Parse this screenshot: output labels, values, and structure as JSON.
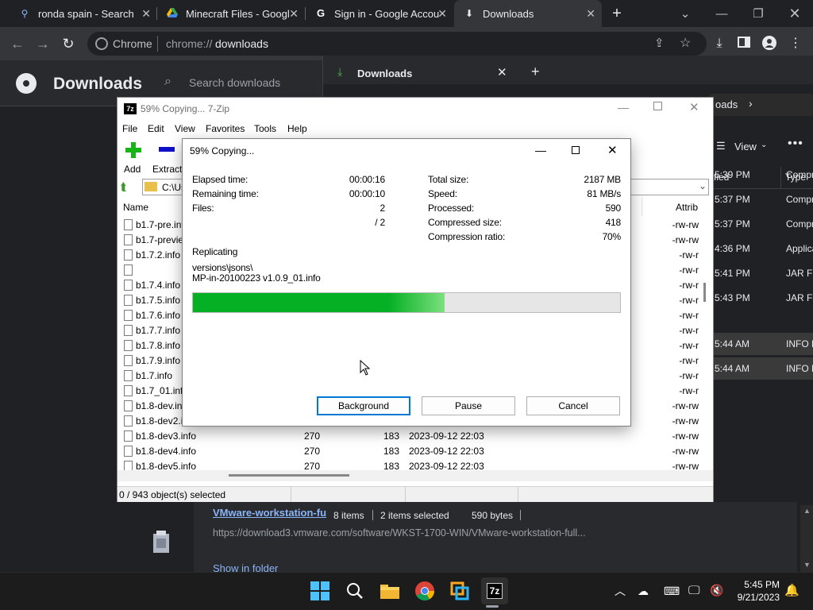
{
  "chrome": {
    "tabs": [
      {
        "label": "ronda spain - Search",
        "icon": "search-icon"
      },
      {
        "label": "Minecraft Files - Googl",
        "icon": "google-drive-icon"
      },
      {
        "label": "Sign in - Google Accou",
        "icon": "google-icon"
      },
      {
        "label": "Downloads",
        "icon": "download-icon"
      }
    ],
    "new_tab": "+",
    "omnibox": {
      "site_label": "Chrome",
      "url_prefix": "chrome://",
      "url_host": "downloads"
    }
  },
  "downloads_page": {
    "title": "Downloads",
    "search_placeholder": "Search downloads",
    "bubble_title": "Downloads",
    "bubble_plus": "+",
    "open_label": "oads",
    "view_label": "View",
    "col_modified": "fied",
    "col_type": "Type",
    "rows": [
      {
        "time": "5:39 PM",
        "type": "Compr"
      },
      {
        "time": "5:37 PM",
        "type": "Compr"
      },
      {
        "time": "5:37 PM",
        "type": "Compr"
      },
      {
        "time": "4:36 PM",
        "type": "Applica"
      },
      {
        "time": "5:41 PM",
        "type": "JAR File"
      },
      {
        "time": "5:43 PM",
        "type": "JAR File"
      },
      {
        "time": "5:44 AM",
        "type": "INFO F"
      },
      {
        "time": "5:44 AM",
        "type": "INFO F"
      }
    ],
    "status_items": "8 items",
    "status_selected": "2 items selected",
    "status_bytes": "590 bytes",
    "item_name": "VMware-workstation-fu",
    "item_url": "https://download3.vmware.com/software/WKST-1700-WIN/VMware-workstation-full...",
    "show_in_folder": "Show in folder"
  },
  "zip_main": {
    "title": "59% Copying... 7-Zip",
    "menu": [
      "File",
      "Edit",
      "View",
      "Favorites",
      "Tools",
      "Help"
    ],
    "toolbar": {
      "add": "Add",
      "extract": "Extract"
    },
    "path": "C:\\Us",
    "col_name": "Name",
    "col_attrib": "Attrib",
    "files": [
      {
        "name": "b1.7-pre.inf",
        "size": "",
        "packed": "",
        "date": "",
        "attr": "-rw-rw"
      },
      {
        "name": "b1.7-previe",
        "size": "",
        "packed": "",
        "date": "",
        "attr": "-rw-rw"
      },
      {
        "name": "b1.7.2.info",
        "size": "",
        "packed": "",
        "date": "",
        "attr": "-rw-r"
      },
      {
        "name": "",
        "size": "",
        "packed": "",
        "date": "",
        "attr": "-rw-r"
      },
      {
        "name": "b1.7.4.info",
        "size": "",
        "packed": "",
        "date": "",
        "attr": "-rw-r"
      },
      {
        "name": "b1.7.5.info",
        "size": "",
        "packed": "",
        "date": "",
        "attr": "-rw-r"
      },
      {
        "name": "b1.7.6.info",
        "size": "",
        "packed": "",
        "date": "",
        "attr": "-rw-r"
      },
      {
        "name": "b1.7.7.info",
        "size": "",
        "packed": "",
        "date": "",
        "attr": "-rw-r"
      },
      {
        "name": "b1.7.8.info",
        "size": "",
        "packed": "",
        "date": "",
        "attr": "-rw-r"
      },
      {
        "name": "b1.7.9.info",
        "size": "",
        "packed": "",
        "date": "",
        "attr": "-rw-r"
      },
      {
        "name": "b1.7.info",
        "size": "",
        "packed": "",
        "date": "",
        "attr": "-rw-r"
      },
      {
        "name": "b1.7_01.info",
        "size": "",
        "packed": "",
        "date": "",
        "attr": "-rw-r"
      },
      {
        "name": "b1.8-dev.in",
        "size": "",
        "packed": "",
        "date": "",
        "attr": "-rw-rw"
      },
      {
        "name": "b1.8-dev2.i",
        "size": "",
        "packed": "",
        "date": "",
        "attr": "-rw-rw"
      },
      {
        "name": "b1.8-dev3.info",
        "size": "270",
        "packed": "183",
        "date": "2023-09-12 22:03",
        "attr": "-rw-rw"
      },
      {
        "name": "b1.8-dev4.info",
        "size": "270",
        "packed": "183",
        "date": "2023-09-12 22:03",
        "attr": "-rw-rw"
      },
      {
        "name": "b1.8-dev5.info",
        "size": "270",
        "packed": "183",
        "date": "2023-09-12 22:03",
        "attr": "-rw-rw"
      }
    ],
    "status": "0 / 943 object(s) selected"
  },
  "dialog": {
    "title": "59% Copying...",
    "elapsed_label": "Elapsed time:",
    "elapsed": "00:00:16",
    "remaining_label": "Remaining time:",
    "remaining": "00:00:10",
    "files_label": "Files:",
    "files": "2",
    "files_total": "/ 2",
    "total_size_label": "Total size:",
    "total_size": "2187 MB",
    "speed_label": "Speed:",
    "speed": "81 MB/s",
    "processed_label": "Processed:",
    "processed": "590",
    "compressed_label": "Compressed size:",
    "compressed": "418",
    "ratio_label": "Compression ratio:",
    "ratio": "70%",
    "operation": "Replicating",
    "path_line1": "versions\\jsons\\",
    "path_line2": "MP-in-20100223 v1.0.9_01.info",
    "progress": 0.59,
    "buttons": {
      "background": "Background",
      "pause": "Pause",
      "cancel": "Cancel"
    }
  },
  "taskbar": {
    "time": "5:45 PM",
    "date": "9/21/2023"
  },
  "colors": {
    "progress_green": "#06b025",
    "accent": "#0078d4",
    "chrome_dark": "#202124"
  }
}
